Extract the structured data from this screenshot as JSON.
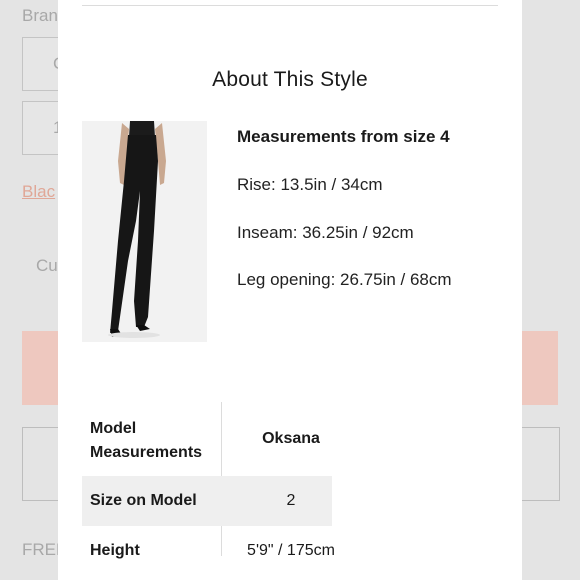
{
  "background": {
    "brand_label": "Bran",
    "box1_text": "C",
    "box2_text": "1",
    "color_link": "Blac",
    "cu_label": "Cu",
    "free_label": "FREE"
  },
  "modal": {
    "title": "About This Style",
    "image_alt": "model wearing black flared high-waist pants",
    "measurements": {
      "heading": "Measurements from size 4",
      "rise": "Rise: 13.5in / 34cm",
      "inseam": "Inseam: 36.25in / 92cm",
      "leg_opening": "Leg opening: 26.75in / 68cm"
    },
    "model_table": {
      "header_label": "Model\nMeasurements",
      "header_value": "Oksana",
      "rows": [
        {
          "label": "Size on Model",
          "value": "2"
        },
        {
          "label": "Height",
          "value": "5'9\" / 175cm"
        }
      ]
    }
  },
  "colors": {
    "accent_pink": "#eec8bf",
    "link_pink": "#e0a797"
  }
}
